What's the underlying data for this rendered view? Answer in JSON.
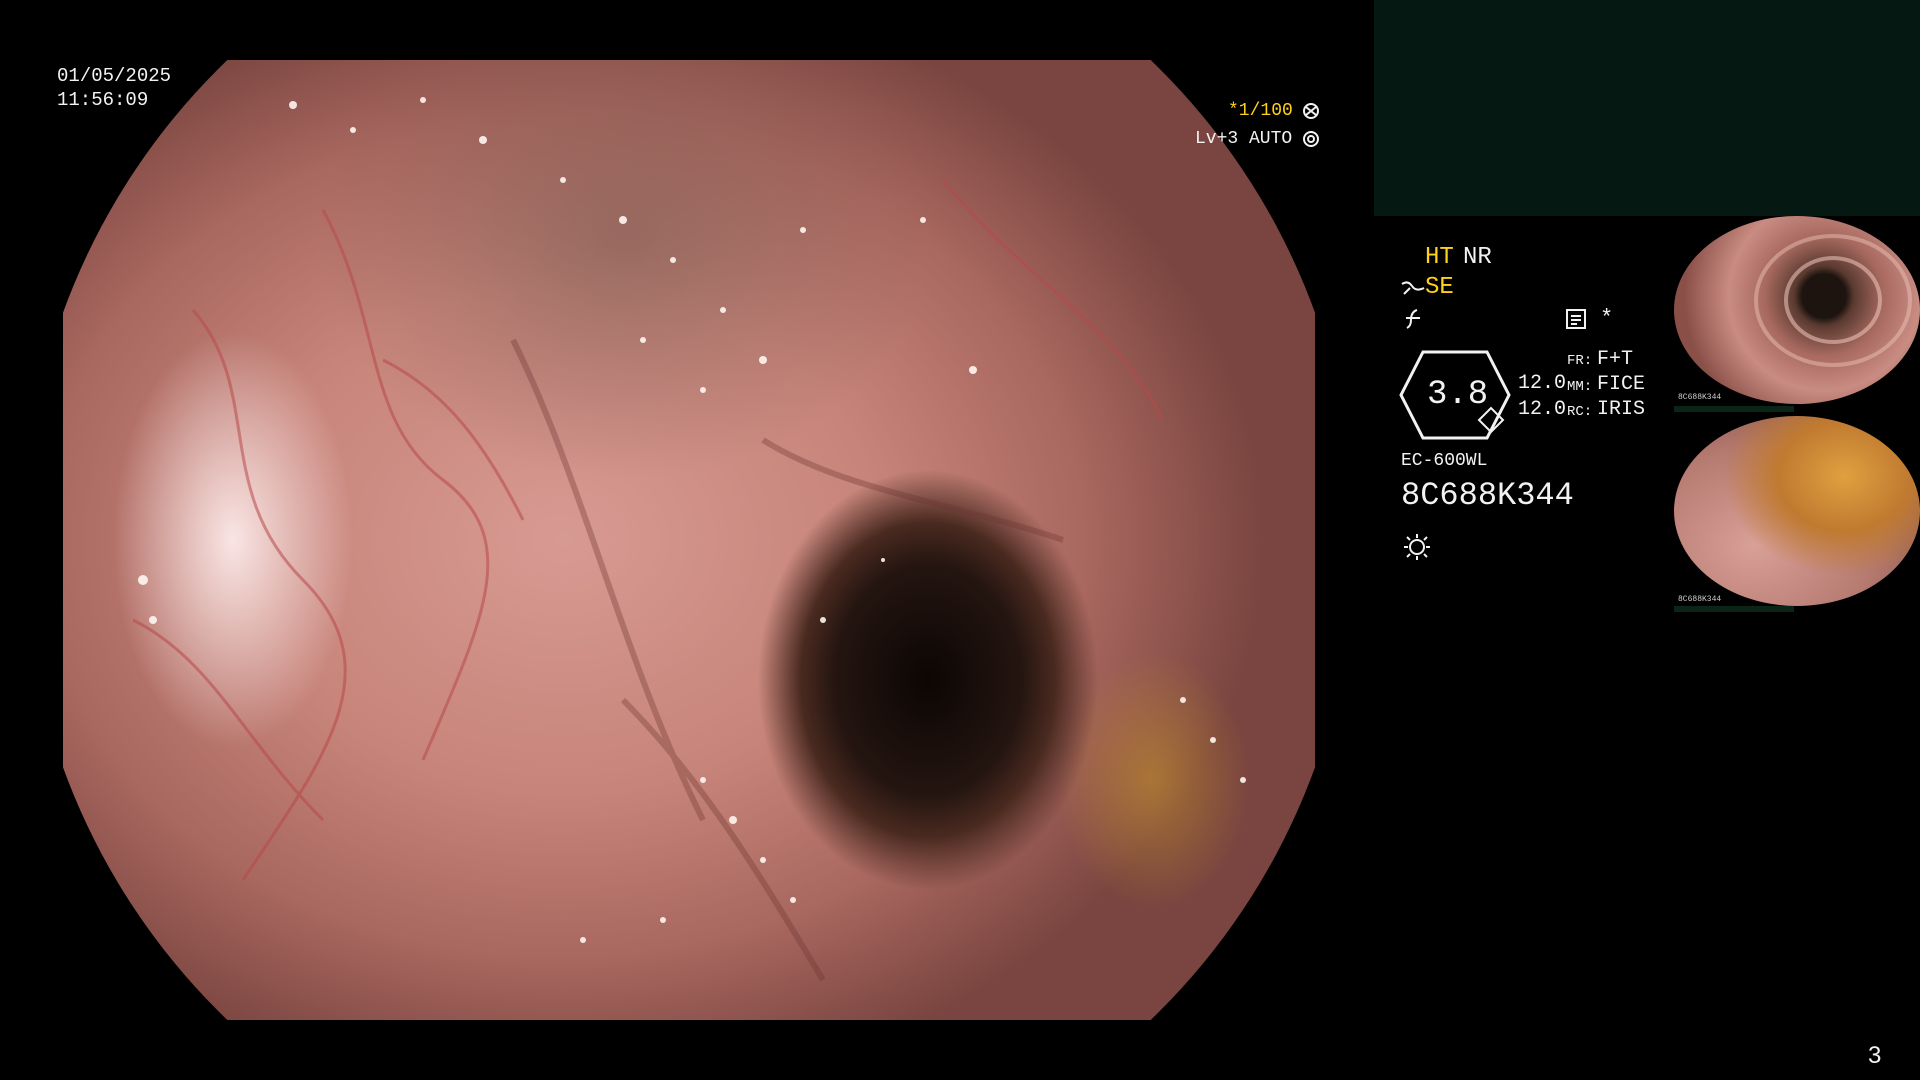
{
  "date": "01/05/2025",
  "time": "11:56:09",
  "shutter_label": "*1/100",
  "light_level": "Lv+3 AUTO",
  "enhancement": {
    "ht": "HT",
    "nr": "NR",
    "se": "SE"
  },
  "iris_value": "3.8",
  "params": {
    "fr_val": "12.0",
    "fr_key": "FR:",
    "fr_mode": "F+T",
    "mm_val": "12.0",
    "mm_key": "MM:",
    "mm_mode": "FICE",
    "rc_key": "RC:",
    "rc_mode": "IRIS"
  },
  "scope_model": "EC-600WL",
  "serial": "8C688K344",
  "asterisk": "*",
  "thumb_serial": "8C688K344",
  "page_number": "3",
  "colors": {
    "overlay_text": "#f2f2f2",
    "accent_yellow": "#ffd21a",
    "panel_green": "#061812"
  },
  "icons": [
    "aperture-icon",
    "target-icon",
    "fiber-icon",
    "flash-off-icon",
    "memo-icon",
    "brightness-icon"
  ]
}
